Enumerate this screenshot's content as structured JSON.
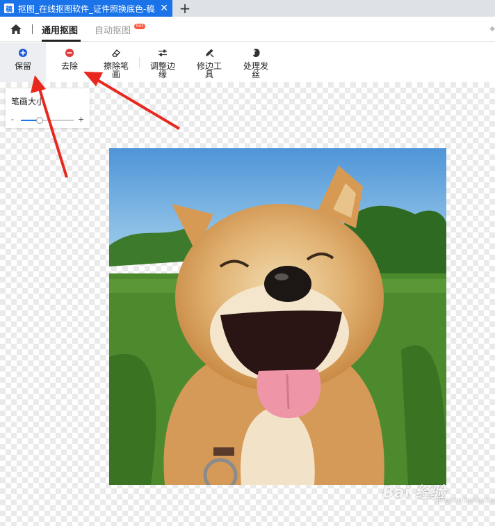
{
  "browser": {
    "tab_title": "抠图_在线抠图软件_证件照换底色-稿",
    "favicon_text": "稿",
    "close_glyph": "✕",
    "new_tab_glyph": "+"
  },
  "header": {
    "tabs": [
      {
        "label": "通用抠图",
        "active": true
      },
      {
        "label": "自动抠图",
        "badge": "hot"
      }
    ]
  },
  "toolbar": {
    "keep": "保留",
    "remove": "去除",
    "erase_stroke": {
      "line1": "擦除笔",
      "line2": "画"
    },
    "adjust_edge": {
      "line1": "调整边",
      "line2": "缘"
    },
    "edge_tool": {
      "line1": "修边工",
      "line2": "具"
    },
    "hair": {
      "line1": "处理发",
      "line2": "丝"
    }
  },
  "brush_panel": {
    "title": "笔画大小",
    "minus": "-",
    "plus": "+",
    "level": 0.35
  },
  "watermark": {
    "text": "Bai 经验",
    "sub": "jingyan.baidu.com"
  },
  "colors": {
    "accent": "#1a73e8",
    "remove_red": "#e03a3a",
    "arrow_red": "#e8281e"
  }
}
